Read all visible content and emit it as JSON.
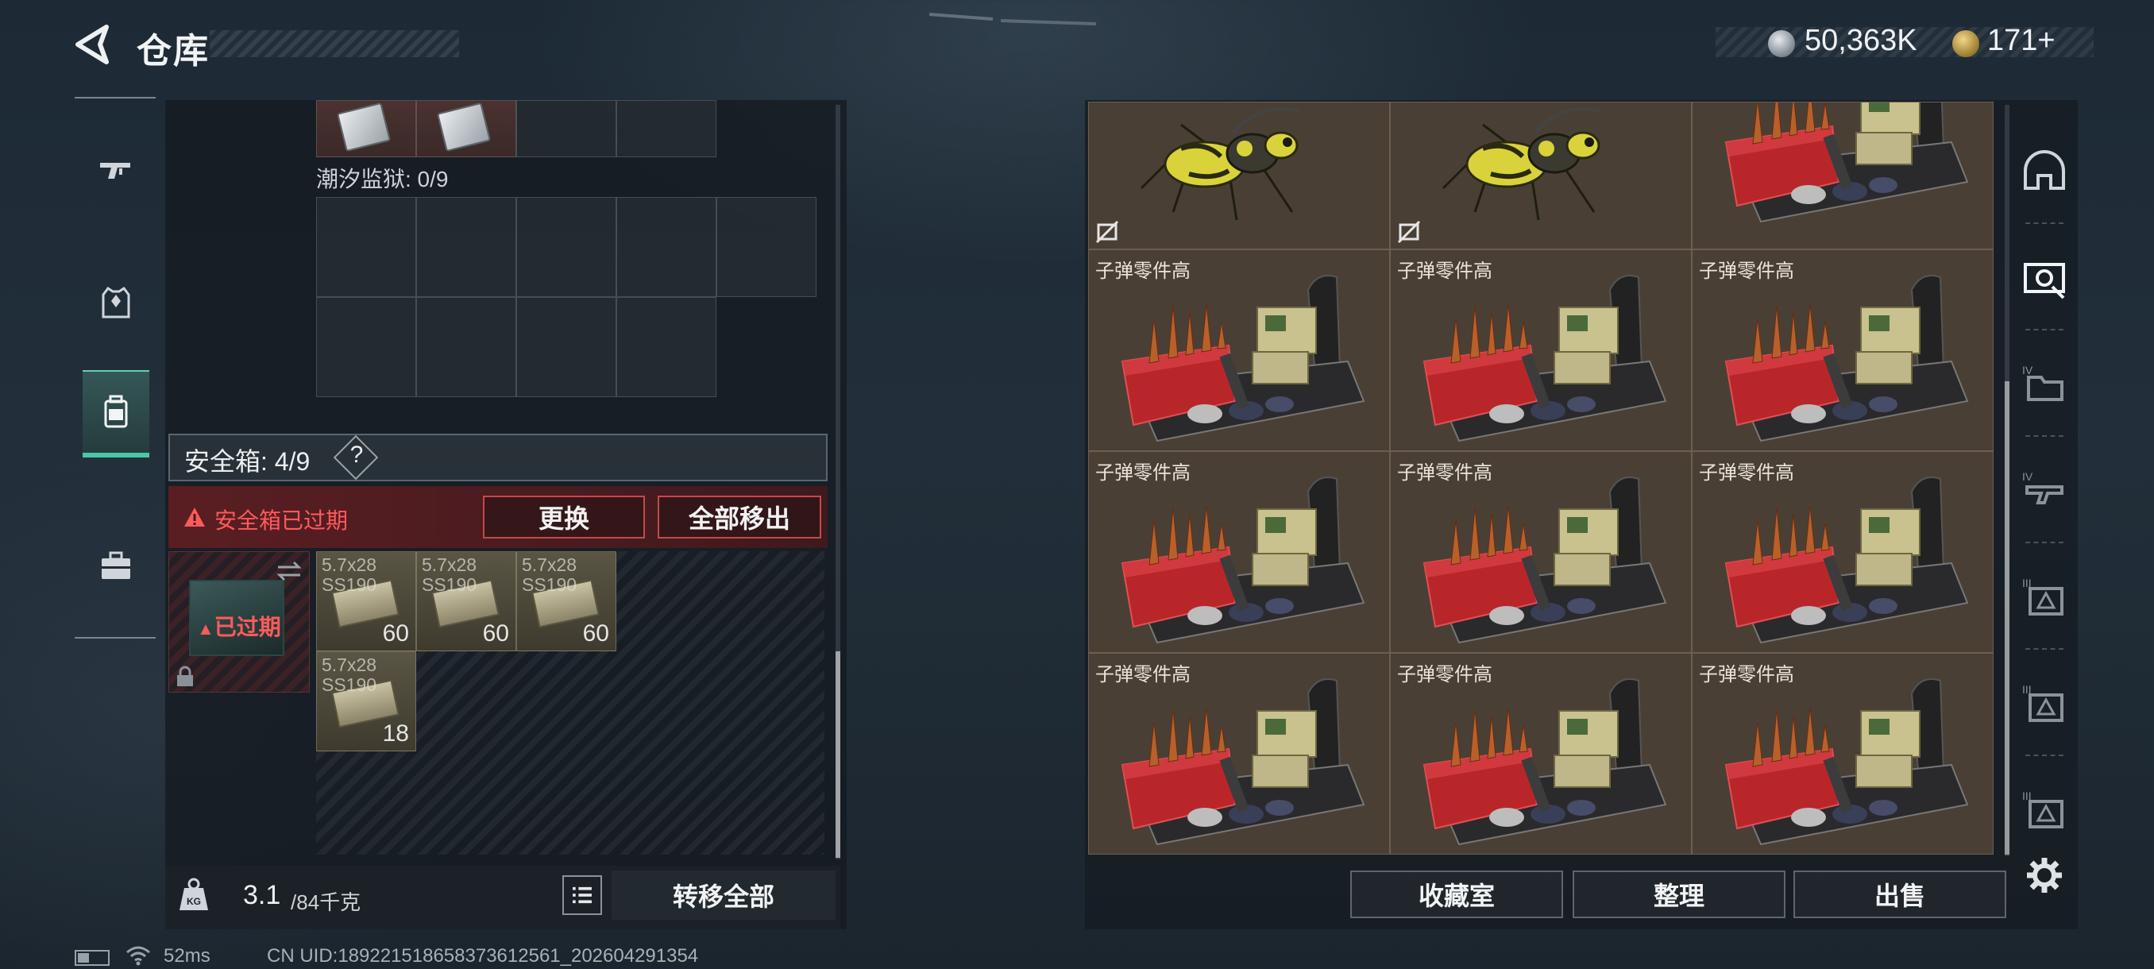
{
  "header": {
    "title": "仓库",
    "currency_silver": "50,363K",
    "currency_gold": "171+"
  },
  "nav": {
    "items": [
      {
        "name": "weapon",
        "icon": "gun-icon"
      },
      {
        "name": "gear",
        "icon": "armor-vest-icon"
      },
      {
        "name": "backpack",
        "icon": "backpack-icon",
        "active": true
      },
      {
        "name": "case",
        "icon": "briefcase-icon"
      }
    ]
  },
  "inventory": {
    "prison_label": "潮汐监狱: 0/9",
    "safe_label": "安全箱: 4/9",
    "help": "?",
    "expired_msg": "安全箱已过期",
    "swap_btn": "更换",
    "move_all_btn": "全部移出",
    "case_expired": "已过期",
    "ammo": [
      {
        "name": "5.7x28 SS190",
        "count": "60"
      },
      {
        "name": "5.7x28 SS190",
        "count": "60"
      },
      {
        "name": "5.7x28 SS190",
        "count": "60"
      },
      {
        "name": "5.7x28 SS190",
        "count": "18"
      }
    ],
    "weight_value": "3.1",
    "weight_max": "/84千克",
    "transfer_all": "转移全部"
  },
  "stash": {
    "item_label": "子弹零件高",
    "buttons": {
      "collection": "收藏室",
      "organize": "整理",
      "sell": "出售"
    }
  },
  "status": {
    "ping": "52ms",
    "uid": "CN UID:18922151865837361256​1_202604291354"
  },
  "colors": {
    "accent_green": "#49c7a6",
    "warning_red": "#ff5a5a",
    "stash_bg": "#473d34"
  }
}
